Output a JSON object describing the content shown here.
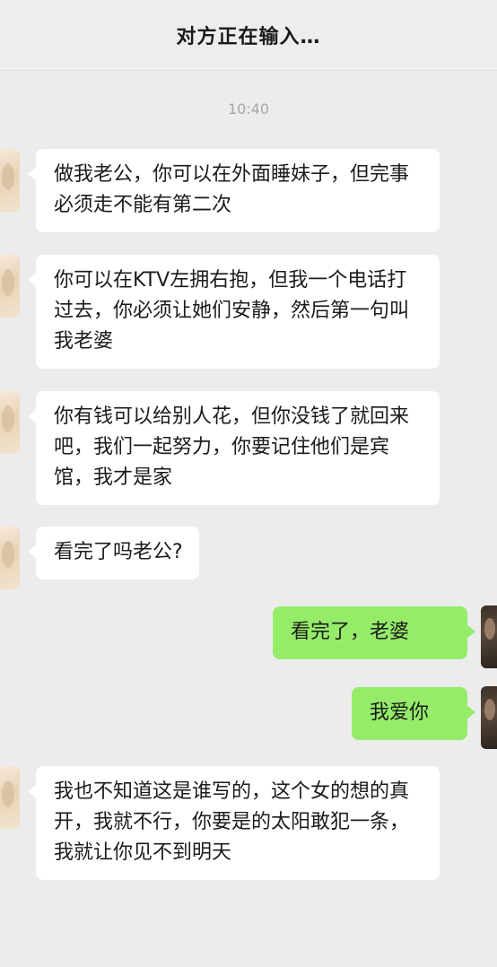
{
  "header": {
    "title": "对方正在输入…"
  },
  "timestamp": "10:40",
  "messages": [
    {
      "side": "left",
      "text": "做我老公，你可以在外面睡妹子，但完事必须走不能有第二次"
    },
    {
      "side": "left",
      "text": "你可以在KTV左拥右抱，但我一个电话打过去，你必须让她们安静，然后第一句叫我老婆"
    },
    {
      "side": "left",
      "text": "你有钱可以给别人花，但你没钱了就回来吧，我们一起努力，你要记住他们是宾馆，我才是家"
    },
    {
      "side": "left",
      "text": "看完了吗老公?"
    },
    {
      "side": "right",
      "text": "看完了，老婆"
    },
    {
      "side": "right",
      "text": "我爱你"
    },
    {
      "side": "left",
      "text": "我也不知道这是谁写的，这个女的想的真开，我就不行，你要是的太阳敢犯一条，我就让你见不到明天"
    }
  ],
  "colors": {
    "background": "#ececec",
    "incoming_bubble": "#ffffff",
    "outgoing_bubble": "#95ec69"
  }
}
